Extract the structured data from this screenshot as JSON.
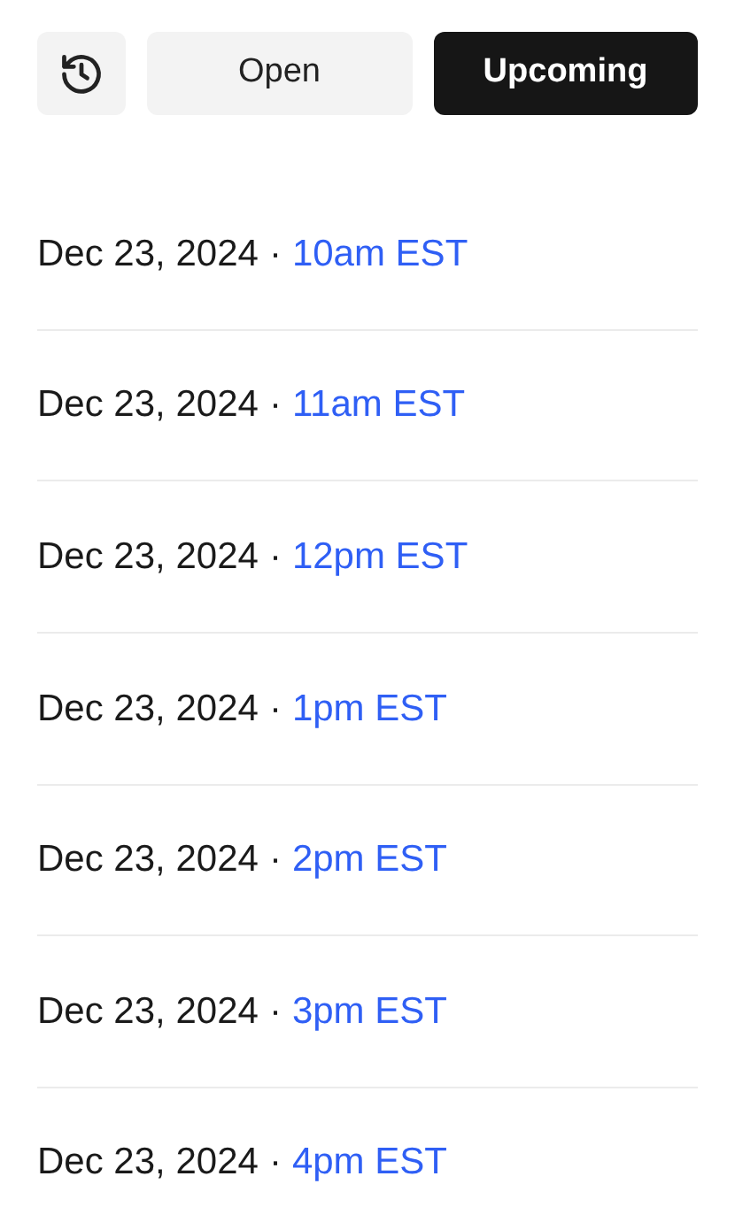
{
  "toolbar": {
    "tabs": [
      {
        "label": "Open",
        "selected": false
      },
      {
        "label": "Upcoming",
        "selected": true
      }
    ]
  },
  "sessions": [
    {
      "date": "Dec 23, 2024",
      "separator": "·",
      "time": "10am EST"
    },
    {
      "date": "Dec 23, 2024",
      "separator": "·",
      "time": "11am EST"
    },
    {
      "date": "Dec 23, 2024",
      "separator": "·",
      "time": "12pm EST"
    },
    {
      "date": "Dec 23, 2024",
      "separator": "·",
      "time": "1pm EST"
    },
    {
      "date": "Dec 23, 2024",
      "separator": "·",
      "time": "2pm EST"
    },
    {
      "date": "Dec 23, 2024",
      "separator": "·",
      "time": "3pm EST"
    },
    {
      "date": "Dec 23, 2024",
      "separator": "·",
      "time": "4pm EST"
    }
  ]
}
